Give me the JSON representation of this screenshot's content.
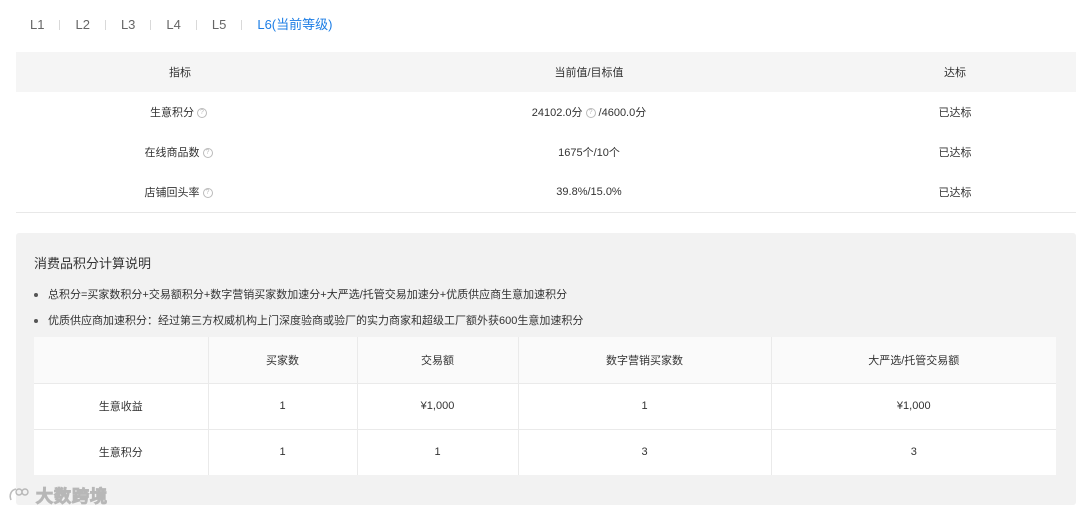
{
  "levels": {
    "tabs": [
      {
        "label": "L1"
      },
      {
        "label": "L2"
      },
      {
        "label": "L3"
      },
      {
        "label": "L4"
      },
      {
        "label": "L5"
      },
      {
        "label": "L6(当前等级)",
        "active": true
      }
    ]
  },
  "criteria": {
    "headers": [
      "指标",
      "当前值/目标值",
      "达标"
    ],
    "rows": [
      {
        "metric": "生意积分",
        "current": "24102.0分",
        "target": "/4600.0分",
        "status": "已达标"
      },
      {
        "metric": "在线商品数",
        "value": "1675个/10个",
        "status": "已达标"
      },
      {
        "metric": "店铺回头率",
        "value": "39.8%/15.0%",
        "status": "已达标"
      }
    ],
    "help_icon": "?"
  },
  "explain": {
    "title": "消费品积分计算说明",
    "bullets": [
      "总积分=买家数积分+交易额积分+数字营销买家数加速分+大严选/托管交易加速分+优质供应商生意加速积分",
      "优质供应商加速积分：经过第三方权威机构上门深度验商或验厂的实力商家和超级工厂额外获600生意加速积分"
    ],
    "table": {
      "headers": [
        "",
        "买家数",
        "交易额",
        "数字营销买家数",
        "大严选/托管交易额"
      ],
      "rows": [
        [
          "生意收益",
          "1",
          "¥1,000",
          "1",
          "¥1,000"
        ],
        [
          "生意积分",
          "1",
          "1",
          "3",
          "3"
        ]
      ]
    }
  },
  "watermark": {
    "text": "大数跨境"
  },
  "colors": {
    "accent": "#1d7ee6",
    "success": "#52c41a",
    "header_bg": "#f5f5f5",
    "panel_bg": "#f2f2f2"
  }
}
